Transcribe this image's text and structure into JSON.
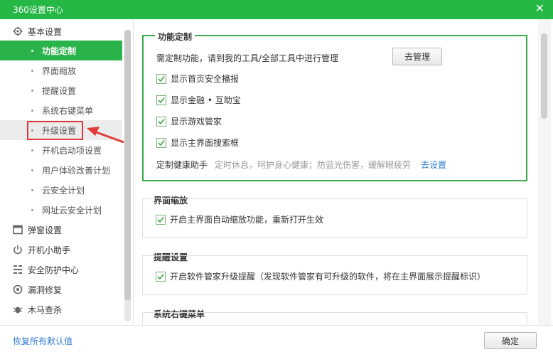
{
  "window": {
    "title": "360设置中心",
    "close_glyph": "✕"
  },
  "sidebar": {
    "groups": [
      {
        "label": "基本设置",
        "icon": "gear-icon"
      },
      {
        "label": "弹窗设置",
        "icon": "window-icon"
      },
      {
        "label": "开机小助手",
        "icon": "power-icon"
      },
      {
        "label": "安全防护中心",
        "icon": "shield-grid-icon"
      },
      {
        "label": "漏洞修复",
        "icon": "patch-icon"
      },
      {
        "label": "木马查杀",
        "icon": "bug-icon"
      }
    ],
    "items": [
      {
        "label": "功能定制"
      },
      {
        "label": "界面缩放"
      },
      {
        "label": "提醒设置"
      },
      {
        "label": "系统右键菜单"
      },
      {
        "label": "升级设置"
      },
      {
        "label": "开机启动项设置"
      },
      {
        "label": "用户体验改善计划"
      },
      {
        "label": "云安全计划"
      },
      {
        "label": "网址云安全计划"
      }
    ]
  },
  "sections": {
    "custom": {
      "title": "功能定制",
      "desc": "需定制功能，请到我的工具/全部工具中进行管理",
      "manage_button": "去管理",
      "options": [
        "显示首页安全播报",
        "显示金融 • 互助宝",
        "显示游戏管家",
        "显示主界面搜索框"
      ],
      "health_label": "定制健康助手",
      "health_desc": "定时休息，呵护身心健康；防蓝光伤害，缓解眼疲劳",
      "health_link": "去设置"
    },
    "zoom": {
      "title": "界面缩放",
      "option": "开启主界面自动缩放功能，重新打开生效"
    },
    "remind": {
      "title": "提醒设置",
      "option": "开启软件管家升级提醒（发现软件管家有可升级的软件，将在主界面展示提醒标识）"
    },
    "context": {
      "title": "系统右键菜单"
    }
  },
  "footer": {
    "reset_link": "恢复所有默认值",
    "ok_button": "确定"
  },
  "colors": {
    "accent": "#25b845",
    "active_item": "#2bb34b",
    "highlight_box": "#e23b3b",
    "link": "#2f7dd1"
  }
}
